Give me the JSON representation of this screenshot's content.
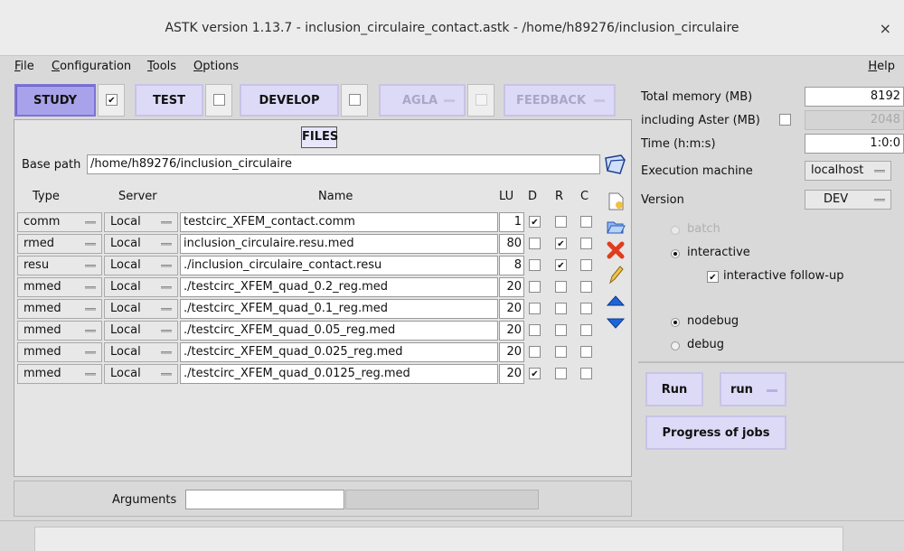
{
  "window": {
    "title": "ASTK version 1.13.7 - inclusion_circulaire_contact.astk - /home/h89276/inclusion_circulaire",
    "close": "×"
  },
  "menu": {
    "file": "File",
    "configuration": "Configuration",
    "tools": "Tools",
    "options": "Options",
    "help": "Help"
  },
  "modes": {
    "study": {
      "label": "STUDY",
      "checked": true
    },
    "test": {
      "label": "TEST",
      "checked": false
    },
    "develop": {
      "label": "DEVELOP",
      "checked": false
    },
    "agla": {
      "label": "AGLA",
      "checked": false
    },
    "feedback": {
      "label": "FEEDBACK"
    }
  },
  "files": {
    "header": "FILES",
    "base_path_label": "Base path",
    "base_path": "/home/h89276/inclusion_circulaire",
    "columns": {
      "type": "Type",
      "server": "Server",
      "name": "Name",
      "lu": "LU",
      "d": "D",
      "r": "R",
      "c": "C"
    },
    "rows": [
      {
        "type": "comm",
        "server": "Local",
        "name": "testcirc_XFEM_contact.comm",
        "lu": "1",
        "d": true,
        "r": false,
        "c": false
      },
      {
        "type": "rmed",
        "server": "Local",
        "name": "inclusion_circulaire.resu.med",
        "lu": "80",
        "d": false,
        "r": true,
        "c": false
      },
      {
        "type": "resu",
        "server": "Local",
        "name": "./inclusion_circulaire_contact.resu",
        "lu": "8",
        "d": false,
        "r": true,
        "c": false
      },
      {
        "type": "mmed",
        "server": "Local",
        "name": "./testcirc_XFEM_quad_0.2_reg.med",
        "lu": "20",
        "d": false,
        "r": false,
        "c": false
      },
      {
        "type": "mmed",
        "server": "Local",
        "name": "./testcirc_XFEM_quad_0.1_reg.med",
        "lu": "20",
        "d": false,
        "r": false,
        "c": false
      },
      {
        "type": "mmed",
        "server": "Local",
        "name": "./testcirc_XFEM_quad_0.05_reg.med",
        "lu": "20",
        "d": false,
        "r": false,
        "c": false
      },
      {
        "type": "mmed",
        "server": "Local",
        "name": "./testcirc_XFEM_quad_0.025_reg.med",
        "lu": "20",
        "d": false,
        "r": false,
        "c": false
      },
      {
        "type": "mmed",
        "server": "Local",
        "name": "./testcirc_XFEM_quad_0.0125_reg.med",
        "lu": "20",
        "d": true,
        "r": false,
        "c": false
      }
    ],
    "arguments_label": "Arguments",
    "arguments_value": ""
  },
  "side_icons": [
    "new-file-icon",
    "open-folder-icon",
    "delete-x-icon",
    "edit-pencil-icon",
    "move-up-icon",
    "move-down-icon"
  ],
  "settings": {
    "total_memory_label": "Total memory (MB)",
    "total_memory": "8192",
    "including_aster_label": "including Aster (MB)",
    "including_aster": "2048",
    "time_label": "Time (h:m:s)",
    "time": "1:0:0",
    "exec_machine_label": "Execution machine",
    "exec_machine": "localhost",
    "version_label": "Version",
    "version": "DEV",
    "batch": "batch",
    "interactive": "interactive",
    "interactive_followup": "interactive follow-up",
    "nodebug": "nodebug",
    "debug": "debug"
  },
  "actions": {
    "run": "Run",
    "run_mode": "run",
    "progress": "Progress of jobs"
  },
  "status": {
    "text": ""
  },
  "colors": {
    "accent": "#a8a2ea",
    "button": "#dcdaf6",
    "delete": "#e23c1c",
    "arrow": "#1e66d8"
  }
}
